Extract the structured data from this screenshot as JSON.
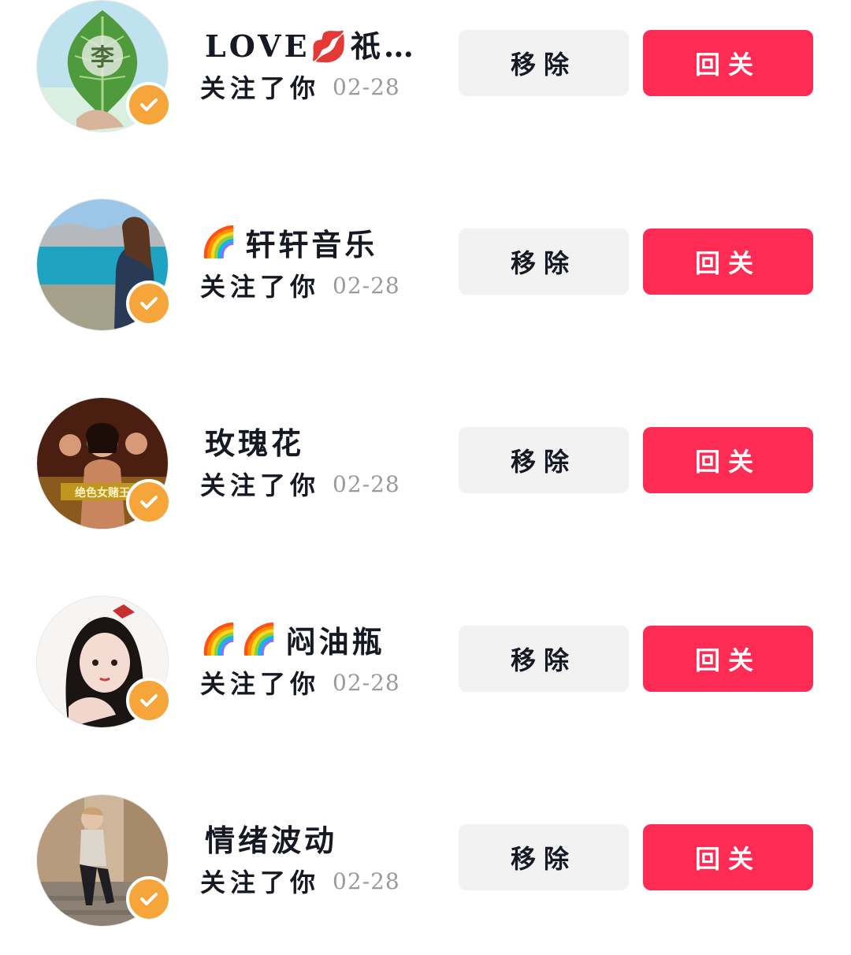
{
  "accent_color": "#fe2c55",
  "badge_color": "#f6a53a",
  "followers": [
    {
      "name_prefix_icon": "",
      "name": "LOVE💋祇…",
      "status": "关注了你",
      "date": "02-28",
      "remove_label": "移除",
      "follow_back_label": "回关",
      "avatar": "leaf-avatar"
    },
    {
      "name_prefix_icon": "🌈",
      "name": "轩轩音乐",
      "status": "关注了你",
      "date": "02-28",
      "remove_label": "移除",
      "follow_back_label": "回关",
      "avatar": "lake-avatar"
    },
    {
      "name_prefix_icon": "",
      "name": "玫瑰花",
      "status": "关注了你",
      "date": "02-28",
      "remove_label": "移除",
      "follow_back_label": "回关",
      "avatar": "poster-avatar"
    },
    {
      "name_prefix_icon": "🌈🌈",
      "name": "闷油瓶",
      "status": "关注了你",
      "date": "02-28",
      "remove_label": "移除",
      "follow_back_label": "回关",
      "avatar": "anime-girl-avatar"
    },
    {
      "name_prefix_icon": "",
      "name": "情绪波动",
      "status": "关注了你",
      "date": "02-28",
      "remove_label": "移除",
      "follow_back_label": "回关",
      "avatar": "street-avatar"
    }
  ]
}
